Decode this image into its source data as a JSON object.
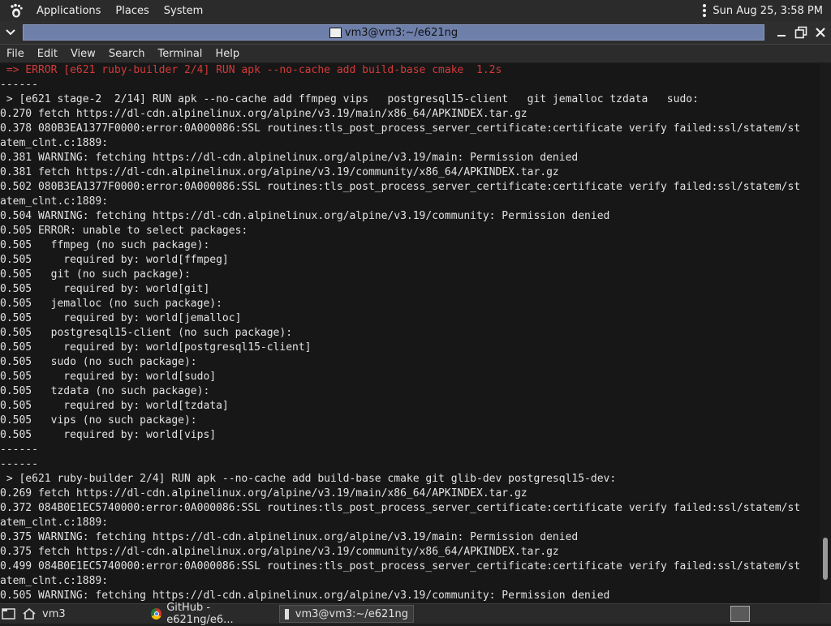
{
  "top_panel": {
    "applications": "Applications",
    "places": "Places",
    "system": "System",
    "clock": "Sun Aug 25,  3:58 PM"
  },
  "window": {
    "title": "vm3@vm3:~/e621ng"
  },
  "menubar": [
    "File",
    "Edit",
    "View",
    "Search",
    "Terminal",
    "Help"
  ],
  "terminal": {
    "lines": [
      {
        "text": " => ERROR [e621 ruby-builder 2/4] RUN apk --no-cache add build-base cmake  1.2s",
        "style": "err"
      },
      {
        "text": "------",
        "style": ""
      },
      {
        "text": " > [e621 stage-2  2/14] RUN apk --no-cache add ffmpeg vips   postgresql15-client   git jemalloc tzdata   sudo:",
        "style": ""
      },
      {
        "text": "0.270 fetch https://dl-cdn.alpinelinux.org/alpine/v3.19/main/x86_64/APKINDEX.tar.gz",
        "style": ""
      },
      {
        "text": "0.378 080B3EA1377F0000:error:0A000086:SSL routines:tls_post_process_server_certificate:certificate verify failed:ssl/statem/st",
        "style": ""
      },
      {
        "text": "atem_clnt.c:1889:",
        "style": ""
      },
      {
        "text": "0.381 WARNING: fetching https://dl-cdn.alpinelinux.org/alpine/v3.19/main: Permission denied",
        "style": ""
      },
      {
        "text": "0.381 fetch https://dl-cdn.alpinelinux.org/alpine/v3.19/community/x86_64/APKINDEX.tar.gz",
        "style": ""
      },
      {
        "text": "0.502 080B3EA1377F0000:error:0A000086:SSL routines:tls_post_process_server_certificate:certificate verify failed:ssl/statem/st",
        "style": ""
      },
      {
        "text": "atem_clnt.c:1889:",
        "style": ""
      },
      {
        "text": "0.504 WARNING: fetching https://dl-cdn.alpinelinux.org/alpine/v3.19/community: Permission denied",
        "style": ""
      },
      {
        "text": "0.505 ERROR: unable to select packages:",
        "style": ""
      },
      {
        "text": "0.505   ffmpeg (no such package):",
        "style": ""
      },
      {
        "text": "0.505     required by: world[ffmpeg]",
        "style": ""
      },
      {
        "text": "0.505   git (no such package):",
        "style": ""
      },
      {
        "text": "0.505     required by: world[git]",
        "style": ""
      },
      {
        "text": "0.505   jemalloc (no such package):",
        "style": ""
      },
      {
        "text": "0.505     required by: world[jemalloc]",
        "style": ""
      },
      {
        "text": "0.505   postgresql15-client (no such package):",
        "style": ""
      },
      {
        "text": "0.505     required by: world[postgresql15-client]",
        "style": ""
      },
      {
        "text": "0.505   sudo (no such package):",
        "style": ""
      },
      {
        "text": "0.505     required by: world[sudo]",
        "style": ""
      },
      {
        "text": "0.505   tzdata (no such package):",
        "style": ""
      },
      {
        "text": "0.505     required by: world[tzdata]",
        "style": ""
      },
      {
        "text": "0.505   vips (no such package):",
        "style": ""
      },
      {
        "text": "0.505     required by: world[vips]",
        "style": ""
      },
      {
        "text": "------",
        "style": ""
      },
      {
        "text": "------",
        "style": ""
      },
      {
        "text": " > [e621 ruby-builder 2/4] RUN apk --no-cache add build-base cmake git glib-dev postgresql15-dev:",
        "style": ""
      },
      {
        "text": "0.269 fetch https://dl-cdn.alpinelinux.org/alpine/v3.19/main/x86_64/APKINDEX.tar.gz",
        "style": ""
      },
      {
        "text": "0.372 084B0E1EC5740000:error:0A000086:SSL routines:tls_post_process_server_certificate:certificate verify failed:ssl/statem/st",
        "style": ""
      },
      {
        "text": "atem_clnt.c:1889:",
        "style": ""
      },
      {
        "text": "0.375 WARNING: fetching https://dl-cdn.alpinelinux.org/alpine/v3.19/main: Permission denied",
        "style": ""
      },
      {
        "text": "0.375 fetch https://dl-cdn.alpinelinux.org/alpine/v3.19/community/x86_64/APKINDEX.tar.gz",
        "style": ""
      },
      {
        "text": "0.499 084B0E1EC5740000:error:0A000086:SSL routines:tls_post_process_server_certificate:certificate verify failed:ssl/statem/st",
        "style": ""
      },
      {
        "text": "atem_clnt.c:1889:",
        "style": ""
      },
      {
        "text": "0.505 WARNING: fetching https://dl-cdn.alpinelinux.org/alpine/v3.19/community: Permission denied",
        "style": ""
      }
    ]
  },
  "taskbar": {
    "workspace_label": "vm3",
    "github_task": "GitHub - e621ng/e6...",
    "terminal_task": "vm3@vm3:~/e621ng"
  },
  "colors": {
    "error_text": "#d43a3a",
    "title_bar_active": "#6e7faa"
  }
}
